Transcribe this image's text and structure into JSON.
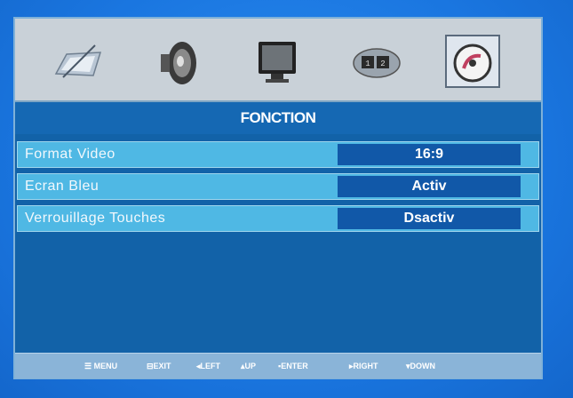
{
  "menu": {
    "title": "FONCTION",
    "tabs": [
      {
        "icon": "picture-icon",
        "selected": false
      },
      {
        "icon": "speaker-icon",
        "selected": false
      },
      {
        "icon": "monitor-icon",
        "selected": false
      },
      {
        "icon": "clock-icon",
        "selected": false
      },
      {
        "icon": "function-icon",
        "selected": true
      }
    ],
    "rows": [
      {
        "label": "Format Video",
        "value": "16:9"
      },
      {
        "label": "Ecran Bleu",
        "value": "Activ"
      },
      {
        "label": "Verrouillage Touches",
        "value": "Dsactiv"
      }
    ]
  },
  "hints": [
    {
      "glyph": "☰",
      "text": "MENU"
    },
    {
      "glyph": "⊟",
      "text": "EXIT"
    },
    {
      "glyph": "◂",
      "text": "LEFT"
    },
    {
      "glyph": "▴",
      "text": "UP"
    },
    {
      "glyph": "▪",
      "text": "ENTER"
    },
    {
      "glyph": "▸",
      "text": "RIGHT"
    },
    {
      "glyph": "▾",
      "text": "DOWN"
    }
  ],
  "colors": {
    "background": "#1e7fe6",
    "panel": "#1262a8",
    "row": "#4fb8e4",
    "value_box": "#1158a8",
    "icon_bar": "#c9d1d8"
  }
}
